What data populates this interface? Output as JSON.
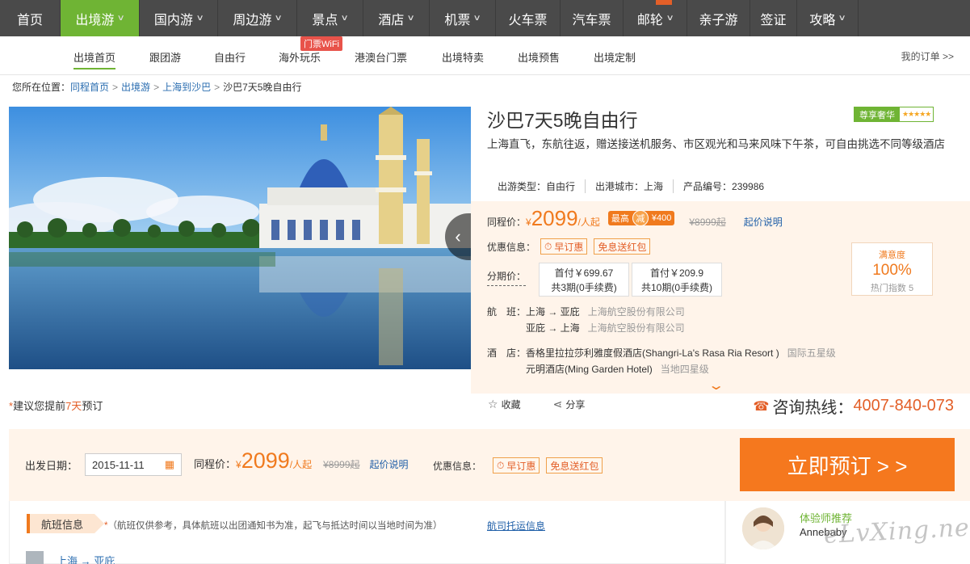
{
  "nav": {
    "items": [
      "首页",
      "出境游",
      "国内游",
      "周边游",
      "景点",
      "酒店",
      "机票",
      "火车票",
      "汽车票",
      "邮轮",
      "亲子游",
      "签证",
      "攻略"
    ]
  },
  "subnav": {
    "items": [
      "出境首页",
      "跟团游",
      "自由行",
      "海外玩乐",
      "港澳台门票",
      "出境特卖",
      "出境预售",
      "出境定制"
    ],
    "wifi_tag": "门票WiFi",
    "my_orders": "我的订单 >>"
  },
  "breadcrumb": {
    "prefix": "您所在位置：",
    "items": [
      "同程首页",
      "出境游",
      "上海到沙巴"
    ],
    "current": "沙巴7天5晚自由行"
  },
  "advice": {
    "star": "*",
    "pre": "建议您提前",
    "days": "7天",
    "post": "预订"
  },
  "product": {
    "title": "沙巴7天5晚自由行",
    "badge": "尊享奢华",
    "badge_stars": "★★★★★",
    "desc": "上海直飞，东航往返，赠送接送机服务、市区观光和马来风味下午茶，可自由挑选不同等级酒店",
    "type": "出游类型：自由行",
    "city": "出港城市：上海",
    "code": "产品编号：239986"
  },
  "price": {
    "label": "同程价：",
    "currency": "¥",
    "value": "2099",
    "unit": "/人起",
    "promo_pre": "最高",
    "promo_mid": "减",
    "promo_amount": "¥400",
    "original": "¥8999起",
    "explain": "起价说明"
  },
  "youhui": {
    "label": "优惠信息：",
    "tags": [
      "早订惠",
      "免息送红包"
    ]
  },
  "fenqi": {
    "label": "分期价：",
    "options": [
      {
        "line1": "首付￥699.67",
        "line2": "共3期(0手续费)"
      },
      {
        "line1": "首付￥209.9",
        "line2": "共10期(0手续费)"
      }
    ]
  },
  "satisfaction": {
    "label": "满意度",
    "value": "100%",
    "sub": "热门指数 5"
  },
  "flight": {
    "label": "航　班：",
    "rows": [
      {
        "route": "上海 → 亚庇",
        "airline": "上海航空股份有限公司"
      },
      {
        "route": "亚庇 → 上海",
        "airline": "上海航空股份有限公司"
      }
    ]
  },
  "hotel": {
    "label": "酒　店：",
    "rows": [
      {
        "name": "香格里拉拉莎利雅度假酒店(Shangri-La's Rasa Ria Resort )",
        "grade": "国际五星级"
      },
      {
        "name": "元明酒店(Ming Garden Hotel)",
        "grade": "当地四星级"
      }
    ]
  },
  "actions": {
    "favorite": "收藏",
    "share": "分享"
  },
  "hotline": {
    "label": "咨询热线：",
    "number": "4007-840-073"
  },
  "booking": {
    "date_label": "出发日期：",
    "date_value": "2015-11-11",
    "price_label": "同程价：",
    "book_button": "立即预订 > >"
  },
  "flight_section": {
    "tab": "航班信息",
    "note_star": "*",
    "note": "（航班仅供参考，具体航班以出团通知书为准，起飞与抵达时间以当地时间为准）",
    "link": "航司托运信息",
    "first_route": "上海 → 亚庇"
  },
  "experience": {
    "title": "体验师推荐",
    "name": "Annebaby"
  },
  "watermark": "eLvXing.net",
  "colors": {
    "nav_bg": "#4a4a4a",
    "nav_active": "#6fb434",
    "accent_orange": "#f07a1e",
    "panel_bg": "#fff4ea",
    "book_button": "#f5781e",
    "link_blue": "#1f5fa8"
  }
}
